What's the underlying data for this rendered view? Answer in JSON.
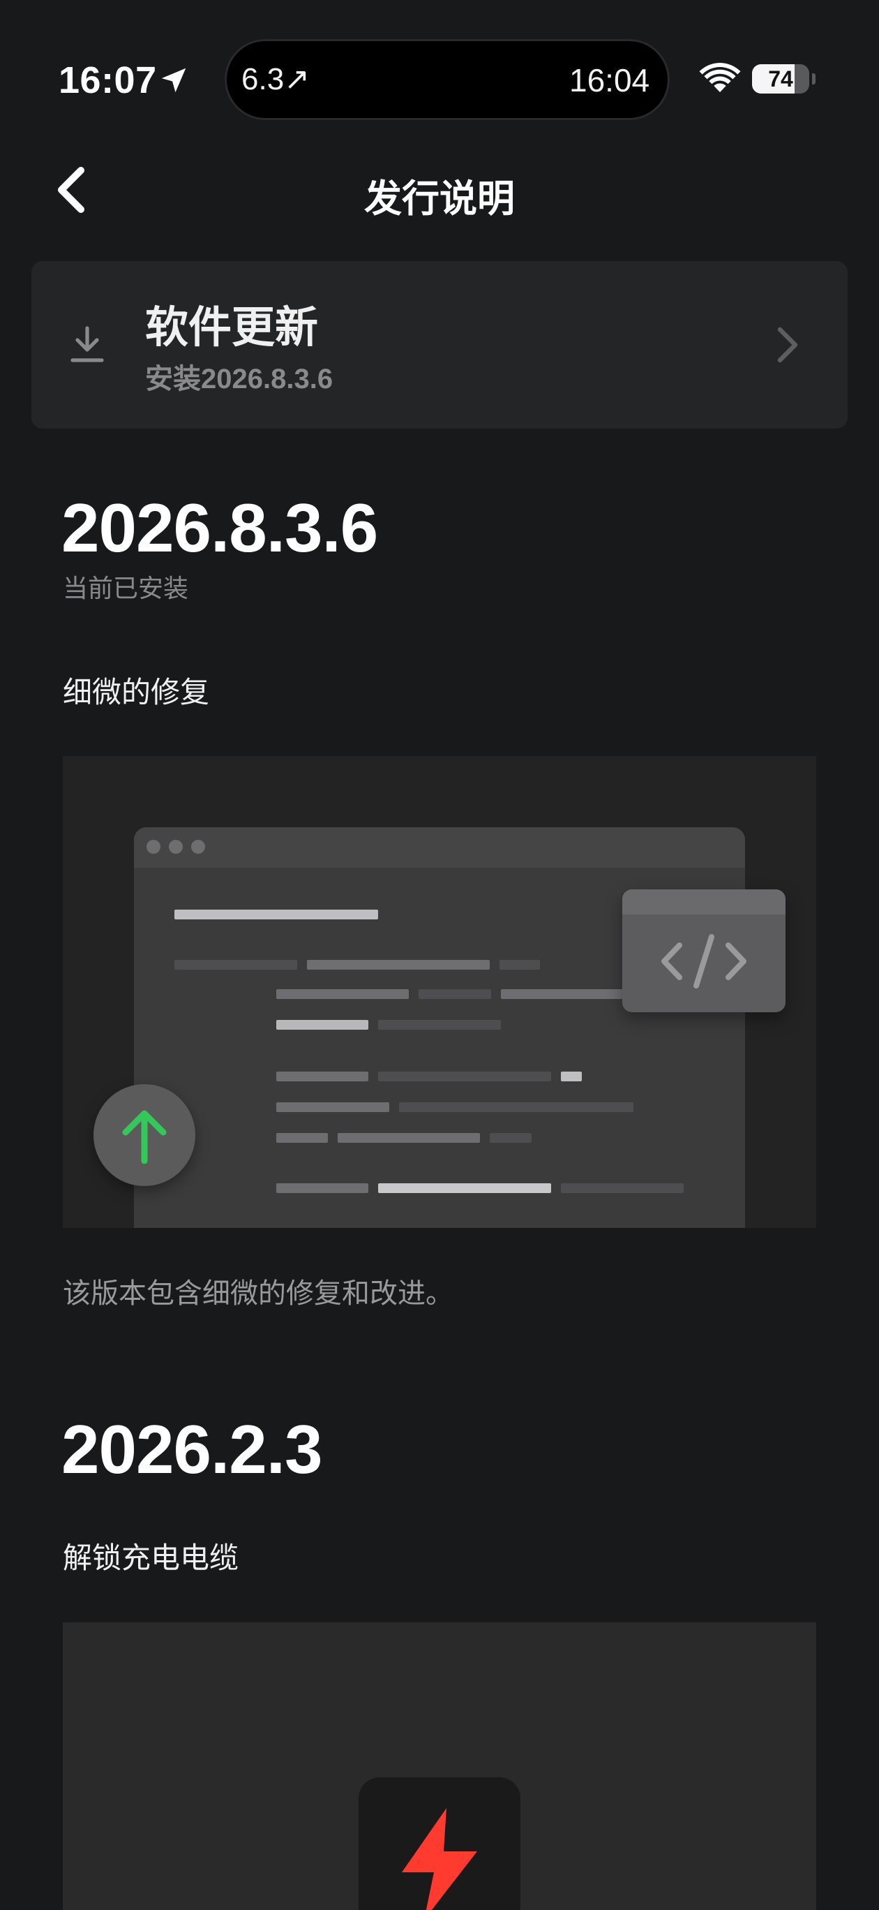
{
  "status_bar": {
    "time": "16:07",
    "island_left": "6.3↗",
    "island_right": "16:04",
    "battery_level": 74,
    "battery_label": "74",
    "icons": [
      "location-arrow-icon",
      "wifi-icon",
      "battery-icon"
    ]
  },
  "nav": {
    "title": "发行说明",
    "back_icon": "chevron-left-icon"
  },
  "update_card": {
    "title": "软件更新",
    "subtitle": "安装2026.8.3.6",
    "icon": "download-icon",
    "chevron_icon": "chevron-right-icon"
  },
  "releases": [
    {
      "version": "2026.8.3.6",
      "status": "当前已安装",
      "heading": "细微的修复",
      "illustration_icons": [
        "code-icon",
        "arrow-up-icon"
      ],
      "description": "该版本包含细微的修复和改进。"
    },
    {
      "version": "2026.2.3",
      "heading": "解锁充电电缆",
      "illustration_icons": [
        "lightning-bolt-icon"
      ]
    }
  ],
  "colors": {
    "background": "#18191b",
    "card": "#242527",
    "accent_green": "#34c759",
    "accent_red": "#ff3b30",
    "muted_text": "#8a8a8d"
  }
}
